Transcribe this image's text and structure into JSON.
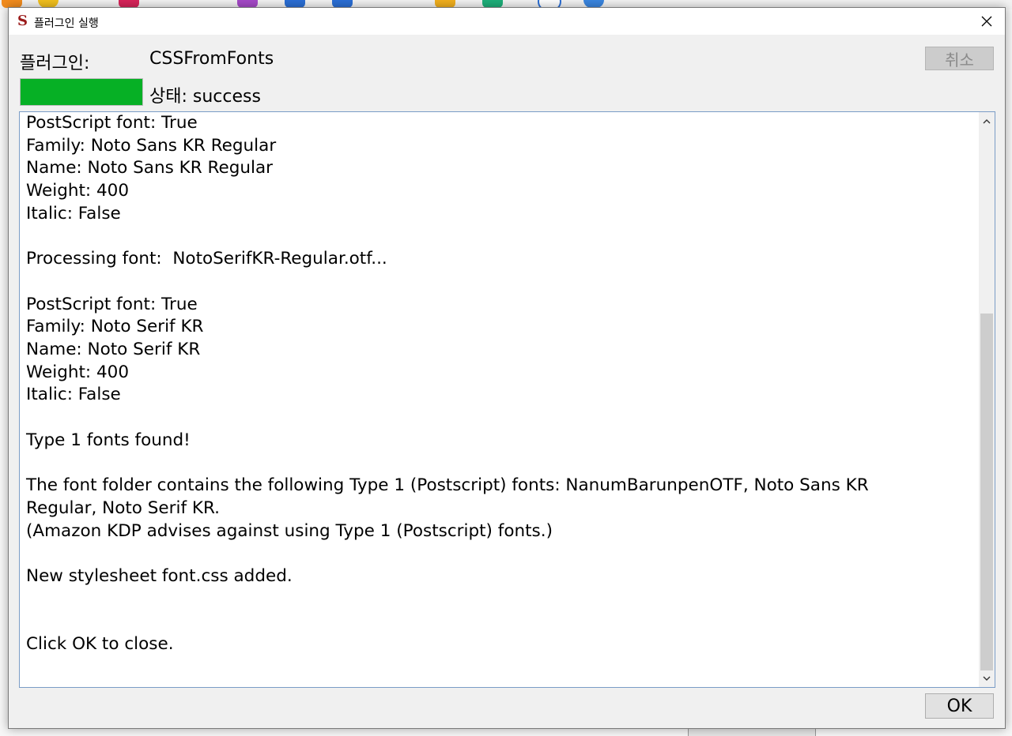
{
  "dialog": {
    "title": "플러그인 실행",
    "plugin_label": "플러그인:",
    "plugin_name": "CSSFromFonts",
    "cancel_label": "취소",
    "status_text": "상태: success",
    "progress_percent": 100,
    "progress_color": "#06b025",
    "ok_label": "OK"
  },
  "log": {
    "lines": [
      "PostScript font: True",
      "Family: Noto Sans KR Regular",
      "Name: Noto Sans KR Regular",
      "Weight: 400",
      "Italic: False",
      "",
      "Processing font:  NotoSerifKR-Regular.otf...",
      "",
      "PostScript font: True",
      "Family: Noto Serif KR",
      "Name: Noto Serif KR",
      "Weight: 400",
      "Italic: False",
      "",
      "Type 1 fonts found!",
      "",
      "The font folder contains the following Type 1 (Postscript) fonts: NanumBarunpenOTF, Noto Sans KR",
      "Regular, Noto Serif KR.",
      "(Amazon KDP advises against using Type 1 (Postscript) fonts.)",
      "",
      "New stylesheet font.css added.",
      "",
      "",
      "Click OK to close."
    ]
  },
  "icons": {
    "app": "sigil-icon",
    "close": "close-icon",
    "scroll_up": "chevron-up-icon",
    "scroll_down": "chevron-down-icon"
  }
}
